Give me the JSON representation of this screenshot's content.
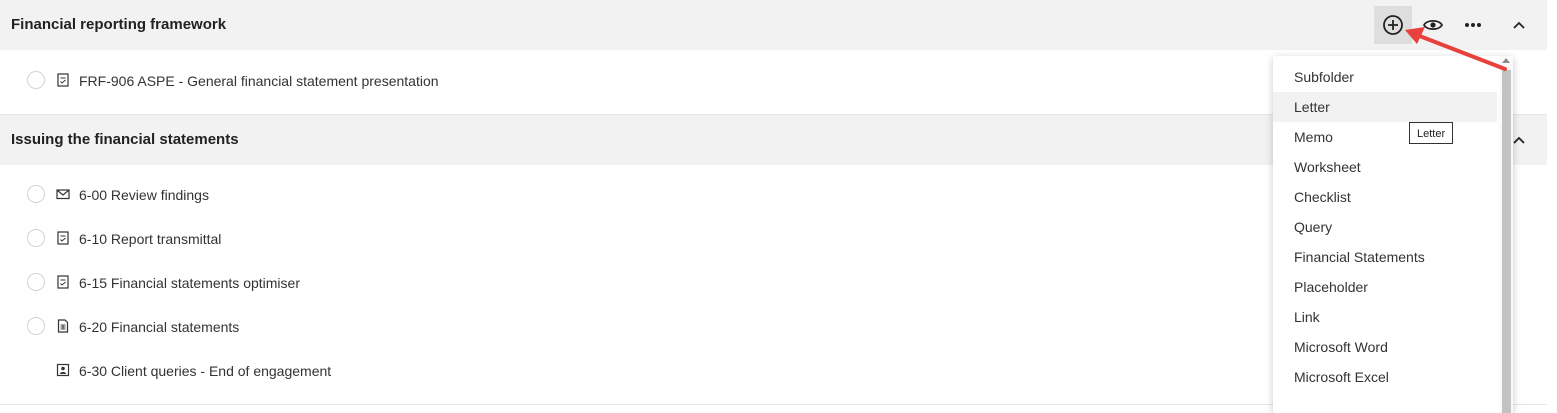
{
  "sections": [
    {
      "title": "Financial reporting framework",
      "rows": [
        {
          "label": "FRF-906 ASPE - General financial statement presentation",
          "icon": "checklist-doc-icon"
        }
      ]
    },
    {
      "title": "Issuing the financial statements",
      "rows": [
        {
          "label": "6-00 Review findings",
          "icon": "envelope-icon"
        },
        {
          "label": "6-10 Report transmittal",
          "icon": "checklist-doc-icon"
        },
        {
          "label": "6-15 Financial statements optimiser",
          "icon": "checklist-doc-icon"
        },
        {
          "label": "6-20 Financial statements",
          "icon": "spreadsheet-doc-icon"
        },
        {
          "label": "6-30 Client queries - End of engagement",
          "icon": "contact-card-icon"
        }
      ]
    }
  ],
  "toolbar": {
    "icons": [
      "add-circle-icon",
      "eye-icon",
      "more-horizontal-icon",
      "chevron-up-icon"
    ]
  },
  "add_menu": {
    "items": [
      "Subfolder",
      "Letter",
      "Memo",
      "Worksheet",
      "Checklist",
      "Query",
      "Financial Statements",
      "Placeholder",
      "Link",
      "Microsoft Word",
      "Microsoft Excel"
    ],
    "hovered": "Letter"
  },
  "tooltip": {
    "text": "Letter"
  },
  "colors": {
    "header_bg": "#f2f2f2",
    "annotation_arrow": "#e8413c",
    "active_button_bg": "#dedede"
  }
}
